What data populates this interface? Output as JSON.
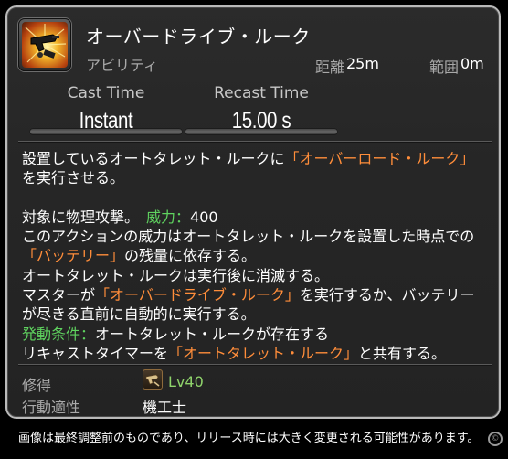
{
  "action": {
    "name": "オーバードライブ・ルーク",
    "type": "アビリティ",
    "icon": "gunblade-turret-icon",
    "range_label": "距離",
    "range_value": "25m",
    "radius_label": "範囲",
    "radius_value": "0m"
  },
  "timing": {
    "cast_label": "Cast Time",
    "cast_value": "Instant",
    "recast_label": "Recast Time",
    "recast_value": "15.00 s"
  },
  "description": {
    "l1_a": "設置しているオートタレット・ルークに",
    "l1_b": "「オーバーロード・ルーク」",
    "l2": "を実行させる。",
    "l3_a": "対象に物理攻撃。",
    "l3_b": "威力：",
    "l3_c": "400",
    "l4": "このアクションの威力はオートタレット・ルークを設置した時点での",
    "l5_a": "「バッテリー」",
    "l5_b": "の残量に依存する。",
    "l6": "オートタレット・ルークは実行後に消滅する。",
    "l7_a": "マスターが",
    "l7_b": "「オーバードライブ・ルーク」",
    "l7_c": "を実行するか、バッテリー",
    "l8": "が尽きる直前に自動的に実行する。",
    "l9_a": "発動条件：",
    "l9_b": "オートタレット・ルークが存在する",
    "l10_a": "リキャストタイマーを",
    "l10_b": "「オートタレット・ルーク」",
    "l10_c": "と共有する。"
  },
  "acquisition": {
    "label": "修得",
    "icon": "machinist-job-icon",
    "level": "Lv40"
  },
  "affinity": {
    "label": "行動適性",
    "value": "機工士"
  },
  "footer": {
    "disclaimer": "画像は最終調整前のものであり、リリース時には大きく変更される可能性があります。",
    "copyright_mark": "©"
  },
  "colors": {
    "highlight": "#ff8d3a",
    "condition": "#5fd35f",
    "level": "#8fd36b"
  }
}
